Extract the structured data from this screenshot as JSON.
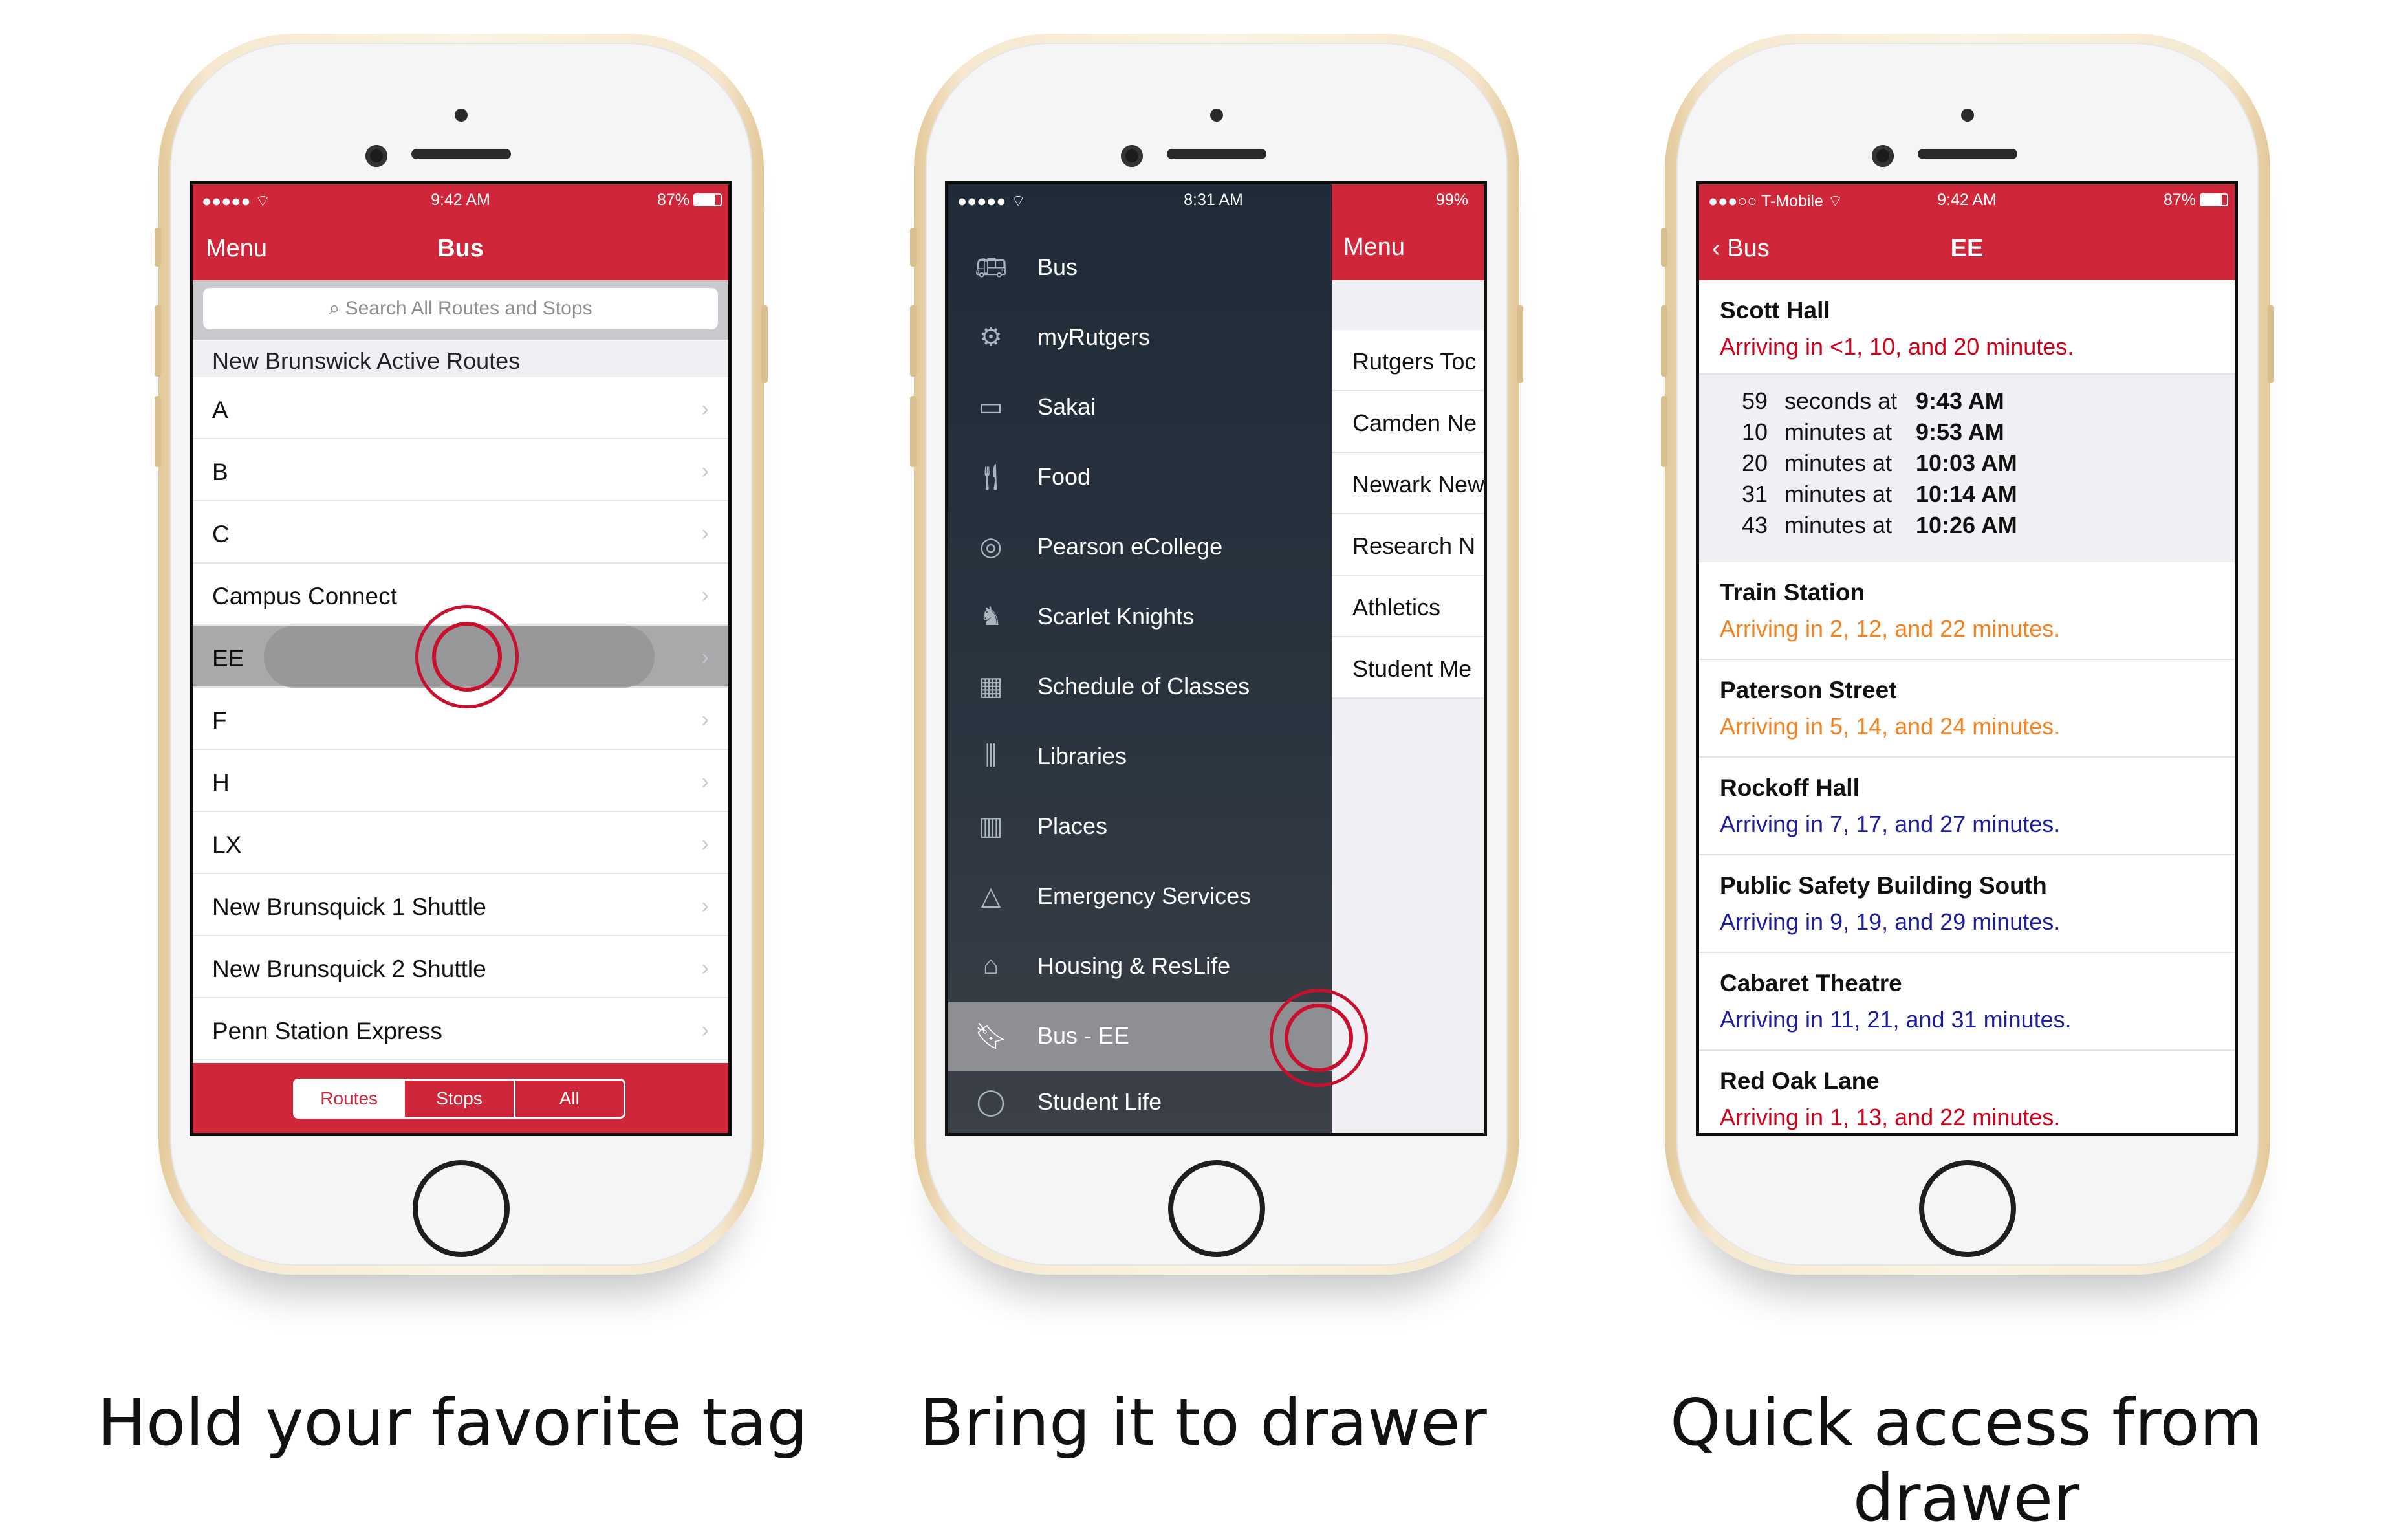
{
  "phone1": {
    "status": {
      "signal": "●●●●● ⌔",
      "time": "9:42 AM",
      "battery": "87%"
    },
    "nav": {
      "left": "Menu",
      "title": "Bus"
    },
    "search_placeholder": "Search All Routes and Stops",
    "section_header": "New Brunswick Active Routes",
    "routes": [
      "A",
      "B",
      "C",
      "Campus Connect",
      "EE",
      "F",
      "H",
      "LX",
      "New Brunsquick 1 Shuttle",
      "New Brunsquick 2 Shuttle",
      "Penn Station Express"
    ],
    "tabs": [
      "Routes",
      "Stops",
      "All"
    ]
  },
  "phone2": {
    "status": {
      "signal": "●●●●● ⌔",
      "time": "8:31 AM",
      "battery": "99%"
    },
    "drawer_items": [
      {
        "label": "Bus",
        "icon": "bus-icon"
      },
      {
        "label": "myRutgers",
        "icon": "myrutgers-icon"
      },
      {
        "label": "Sakai",
        "icon": "sakai-icon"
      },
      {
        "label": "Food",
        "icon": "food-icon"
      },
      {
        "label": "Pearson eCollege",
        "icon": "pearson-icon"
      },
      {
        "label": "Scarlet Knights",
        "icon": "knight-icon"
      },
      {
        "label": "Schedule of Classes",
        "icon": "schedule-icon"
      },
      {
        "label": "Libraries",
        "icon": "libraries-icon"
      },
      {
        "label": "Places",
        "icon": "places-icon"
      },
      {
        "label": "Emergency Services",
        "icon": "emergency-icon"
      },
      {
        "label": "Housing & ResLife",
        "icon": "house-icon"
      },
      {
        "label": "Bus - EE",
        "icon": "bookmark-icon"
      },
      {
        "label": "Student Life",
        "icon": "student-life-icon"
      }
    ],
    "peek_nav": "Menu",
    "peek_items": [
      "Rutgers Toc",
      "Camden Ne",
      "Newark New",
      "Research N",
      "Athletics",
      "Student Me"
    ]
  },
  "phone3": {
    "status": {
      "signal": "●●●○○ T-Mobile ⌔",
      "time": "9:42 AM",
      "battery": "87%"
    },
    "nav": {
      "back": "Bus",
      "title": "EE"
    },
    "stops": [
      {
        "name": "Scott Hall",
        "arrival": "Arriving in <1, 10, and 20 minutes.",
        "color": "#d0021b"
      },
      {
        "name": "Train Station",
        "arrival": "Arriving in 2, 12, and 22 minutes.",
        "color": "#f5821f"
      },
      {
        "name": "Paterson Street",
        "arrival": "Arriving in 5, 14, and 24 minutes.",
        "color": "#f5821f"
      },
      {
        "name": "Rockoff Hall",
        "arrival": "Arriving in 7, 17, and 27 minutes.",
        "color": "#1e1ea0"
      },
      {
        "name": "Public Safety Building South",
        "arrival": "Arriving in 9, 19, and 29 minutes.",
        "color": "#1e1ea0"
      },
      {
        "name": "Cabaret Theatre",
        "arrival": "Arriving in 11, 21, and 31 minutes.",
        "color": "#1e1ea0"
      },
      {
        "name": "Red Oak Lane",
        "arrival": "Arriving in 1, 13, and 22 minutes.",
        "color": "#d0021b"
      }
    ],
    "schedule": [
      {
        "n": "59",
        "unit": "seconds at",
        "time": "9:43 AM"
      },
      {
        "n": "10",
        "unit": "minutes at",
        "time": "9:53 AM"
      },
      {
        "n": "20",
        "unit": "minutes at",
        "time": "10:03 AM"
      },
      {
        "n": "31",
        "unit": "minutes at",
        "time": "10:14 AM"
      },
      {
        "n": "43",
        "unit": "minutes at",
        "time": "10:26 AM"
      }
    ]
  },
  "captions": [
    "Hold your favorite tag",
    "Bring it to drawer",
    "Quick access from drawer"
  ],
  "colors": {
    "brand_red": "#d0263a",
    "drawer_bg": "#1f2b38",
    "orange": "#f5821f",
    "blue": "#1e1ea0"
  }
}
